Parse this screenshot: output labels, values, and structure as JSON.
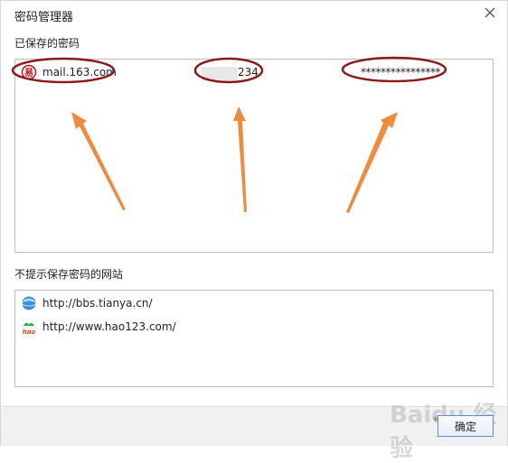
{
  "dialog": {
    "title": "密码管理器",
    "ok_label": "确定"
  },
  "saved_section": {
    "label": "已保存的密码",
    "entries": [
      {
        "site": "mail.163.com",
        "username": "234",
        "password": "****************",
        "icon": "mail-163-icon"
      }
    ]
  },
  "never_section": {
    "label": "不提示保存密码的网站",
    "sites": [
      {
        "site": "http://bbs.tianya.cn/",
        "icon": "tianya-globe-icon"
      },
      {
        "site": "http://www.hao123.com/",
        "icon": "hao123-icon"
      }
    ]
  },
  "watermark": "Baidu 经验",
  "colors": {
    "annotation_ellipse": "#8b1a1a",
    "annotation_arrow": "#f08a3c",
    "ok_border": "#5a8fd3"
  }
}
